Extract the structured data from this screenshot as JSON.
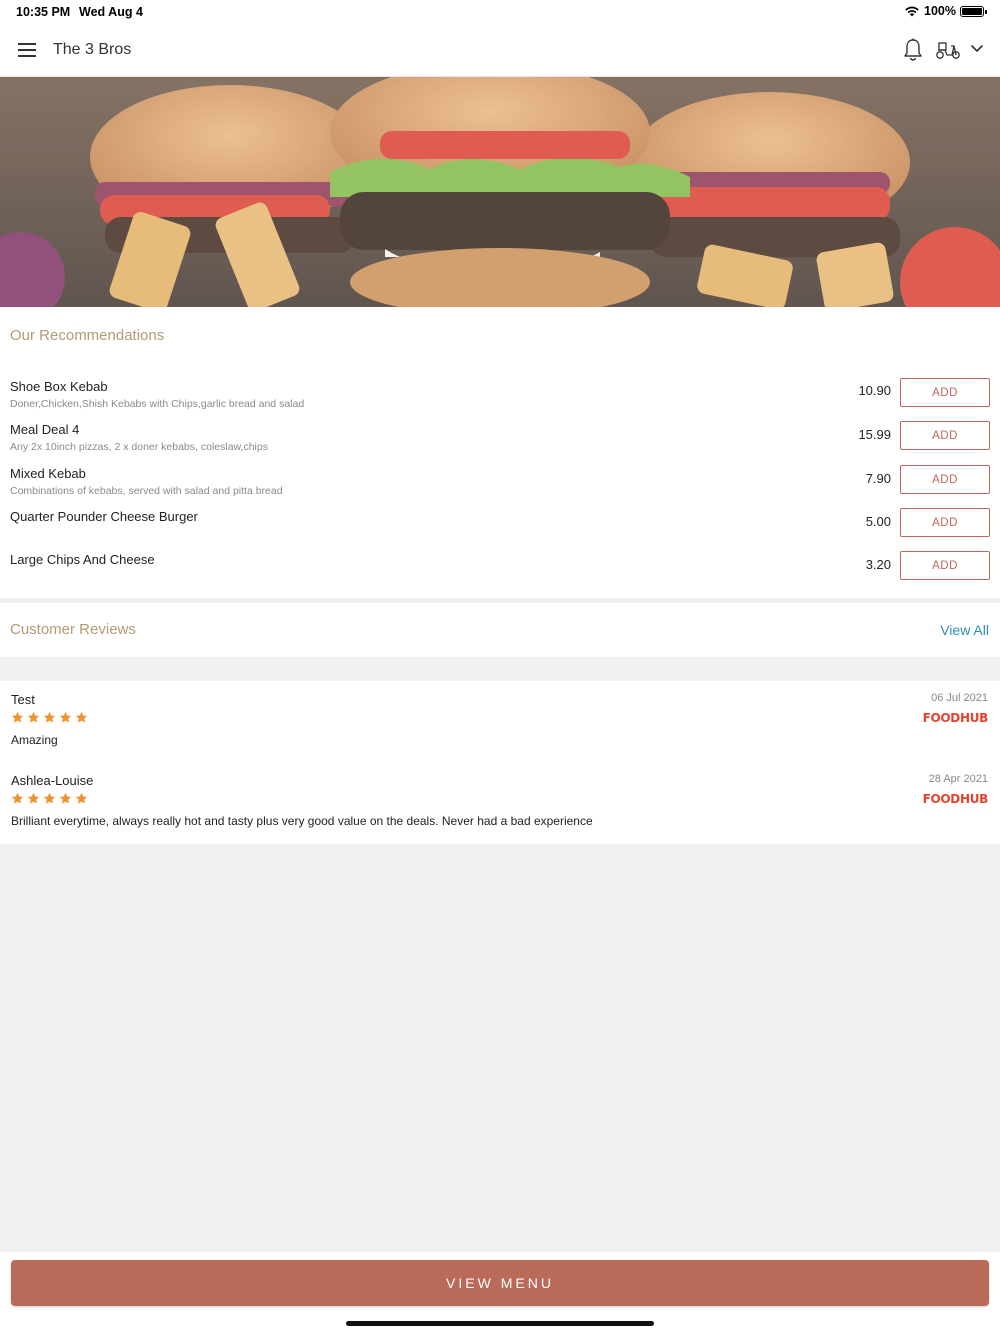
{
  "status_bar": {
    "time": "10:35 PM",
    "date": "Wed Aug 4",
    "battery": "100%"
  },
  "header": {
    "title": "The 3 Bros",
    "icons": [
      "menu-icon",
      "bell-icon",
      "scooter-icon",
      "chevron-down-icon"
    ]
  },
  "recommendations": {
    "title": "Our Recommendations",
    "add_label": "ADD",
    "items": [
      {
        "name": "Shoe Box Kebab",
        "description": "Doner,Chicken,Shish Kebabs with Chips,garlic bread and salad",
        "price": "10.90"
      },
      {
        "name": "Meal Deal 4",
        "description": "Any 2x 10inch pizzas, 2 x doner kebabs, coleslaw,chips",
        "price": "15.99"
      },
      {
        "name": "Mixed Kebab",
        "description": "Combinations of kebabs, served with salad and pitta bread",
        "price": "7.90"
      },
      {
        "name": "Quarter Pounder Cheese Burger",
        "description": "",
        "price": "5.00"
      },
      {
        "name": "Large Chips And Cheese",
        "description": "",
        "price": "3.20"
      }
    ]
  },
  "reviews": {
    "title": "Customer Reviews",
    "view_all": "View All",
    "items": [
      {
        "author": "Test",
        "rating": 5,
        "text": "Amazing",
        "date": "06 Jul 2021",
        "source": "FOODHUB"
      },
      {
        "author": "Ashlea-Louise",
        "rating": 5,
        "text": "Brilliant everytime, always really hot and tasty plus very good value on the deals. Never had a bad experience",
        "date": "28 Apr 2021",
        "source": "FOODHUB"
      }
    ]
  },
  "bottom": {
    "view_menu": "VIEW MENU"
  },
  "colors": {
    "accent": "#b96a58",
    "add_border": "#c0665a",
    "section_title": "#b39a74",
    "link": "#2d8fb3",
    "star": "#f2922f",
    "foodhub": "#e8422f"
  }
}
